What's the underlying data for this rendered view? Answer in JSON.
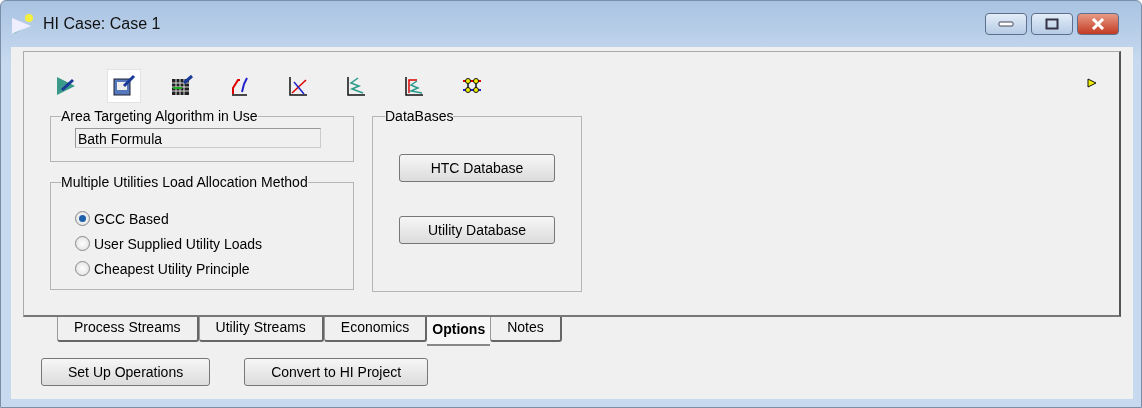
{
  "window": {
    "title": "HI Case: Case 1"
  },
  "toolbar": [
    {
      "selected": false
    },
    {
      "selected": true
    },
    {
      "selected": false
    },
    {
      "selected": false
    },
    {
      "selected": false
    },
    {
      "selected": false
    },
    {
      "selected": false
    },
    {
      "selected": false
    }
  ],
  "area_targeting": {
    "title": "Area Targeting Algorithm in Use",
    "value": "Bath Formula"
  },
  "load_allocation": {
    "title": "Multiple Utilities Load Allocation Method",
    "options": [
      {
        "label": "GCC Based",
        "selected": true
      },
      {
        "label": "User Supplied Utility Loads",
        "selected": false
      },
      {
        "label": "Cheapest Utility Principle",
        "selected": false
      }
    ]
  },
  "databases": {
    "title": "DataBases",
    "buttons": [
      "HTC Database",
      "Utility Database"
    ]
  },
  "tabs": [
    {
      "label": "Process Streams",
      "selected": false
    },
    {
      "label": "Utility Streams",
      "selected": false
    },
    {
      "label": "Economics",
      "selected": false
    },
    {
      "label": "Options",
      "selected": true
    },
    {
      "label": "Notes",
      "selected": false
    }
  ],
  "buttons": [
    "Set Up Operations",
    "Convert to HI Project"
  ]
}
